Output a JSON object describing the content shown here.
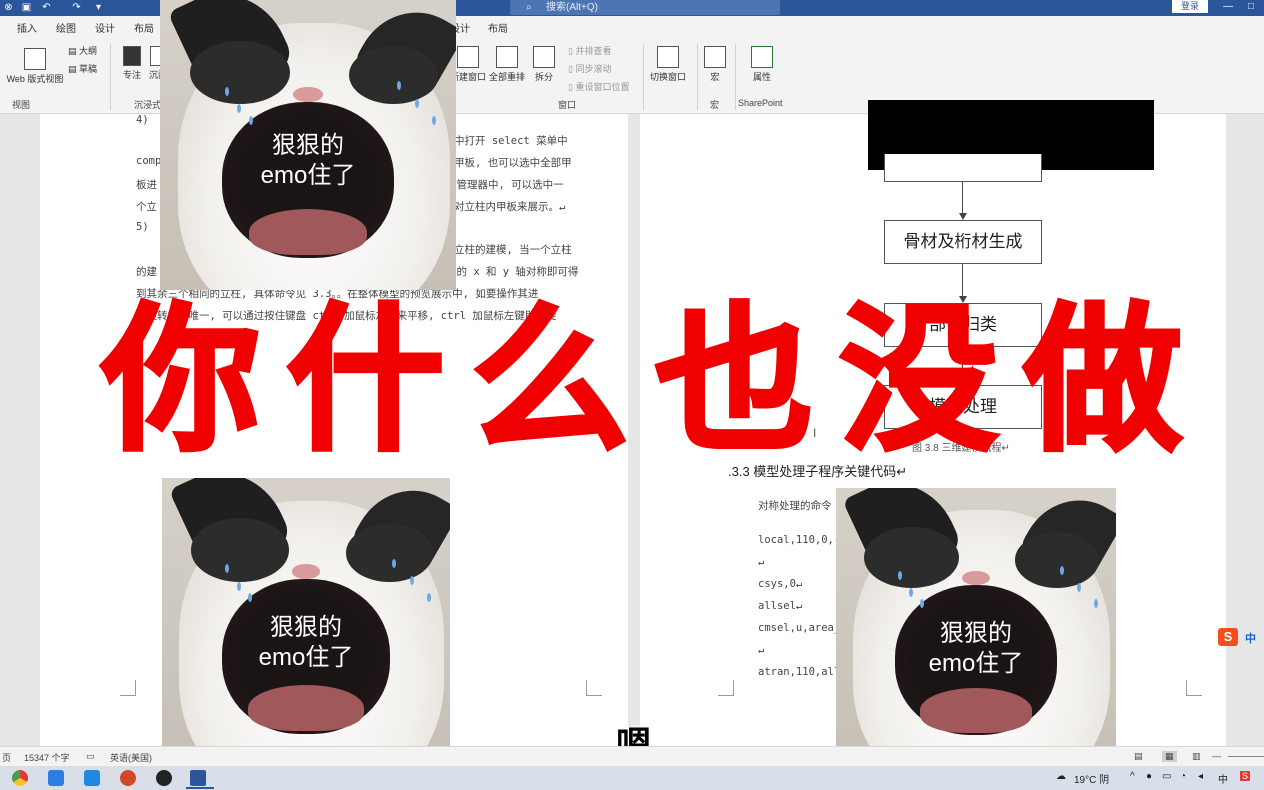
{
  "titlebar": {
    "search_placeholder": "搜索(Alt+Q)",
    "login_label": "登录",
    "window_controls": "— □"
  },
  "ribbon": {
    "tabs": [
      "插入",
      "绘图",
      "设计",
      "布局",
      "设计",
      "布局"
    ],
    "buttons": {
      "web_layout": "Web 版式视图",
      "outline": "大纲",
      "draft": "草稿",
      "focus": "专注",
      "immersive": "沉阅",
      "new_window": "新建窗口",
      "arrange_all": "全部重排",
      "split": "拆分",
      "side_by_side": "并排查看",
      "sync_scroll": "同步滚动",
      "reset_pos": "重设窗口位置",
      "switch_window": "切换窗口",
      "macros": "宏",
      "properties": "属性"
    },
    "groups": {
      "view": "视图",
      "immersive": "沉浸式",
      "window": "窗口",
      "macros": "宏",
      "sharepoint": "SharePoint"
    }
  },
  "left_page": {
    "lines": [
      "4)",
      "中打开 select 菜单中",
      "comp",
      "甲板, 也可以选中全部甲",
      "板进",
      "在管理器中, 可以选中一",
      "个立",
      "对立柱内甲板来展示。↵",
      "5)",
      "立柱的建模, 当一个立柱",
      "的建",
      "系的 x 和 y 轴对称即可得",
      "到其余三个相同的立柱, 具体命令见 3.3。。在整体模型的预览展示中, 如要操作其进",
      "行旋转或者唯一, 可以通过按住键盘 ctrl 加鼠标左键来平移, ctrl 加鼠标左键即是旋",
      "。"
    ]
  },
  "right_page": {
    "flowchart": [
      "骨材及桁材生成",
      "部件归类",
      "模型处理"
    ],
    "figure_caption": "图 3.8 三维建模流程↵",
    "heading": ".3.3 模型处理子程序关键代码↵",
    "code_lines": [
      "对称处理的命令",
      "local,110,0,-0",
      "↵",
      "csys,0↵",
      "allsel↵",
      "cmsel,u,area_l",
      "↵",
      "atran,110,all,"
    ]
  },
  "meme": {
    "caption_line1": "狠狠的",
    "caption_line2": "emo住了"
  },
  "overlay": {
    "headline_chars": [
      "你",
      "什",
      "么",
      "也",
      "没",
      "做"
    ],
    "subtitle": "嗯"
  },
  "statusbar": {
    "page": "页",
    "word_count": "15347 个字",
    "language": "英语(美国)"
  },
  "taskbar": {
    "weather": "19°C 阴",
    "ime": "中"
  },
  "ime_indicator": {
    "logo": "S",
    "label": "中"
  },
  "colors": {
    "title_bar": "#2b579a",
    "headline_red": "#f00000",
    "ribbon_bg": "#f3f3f3"
  }
}
